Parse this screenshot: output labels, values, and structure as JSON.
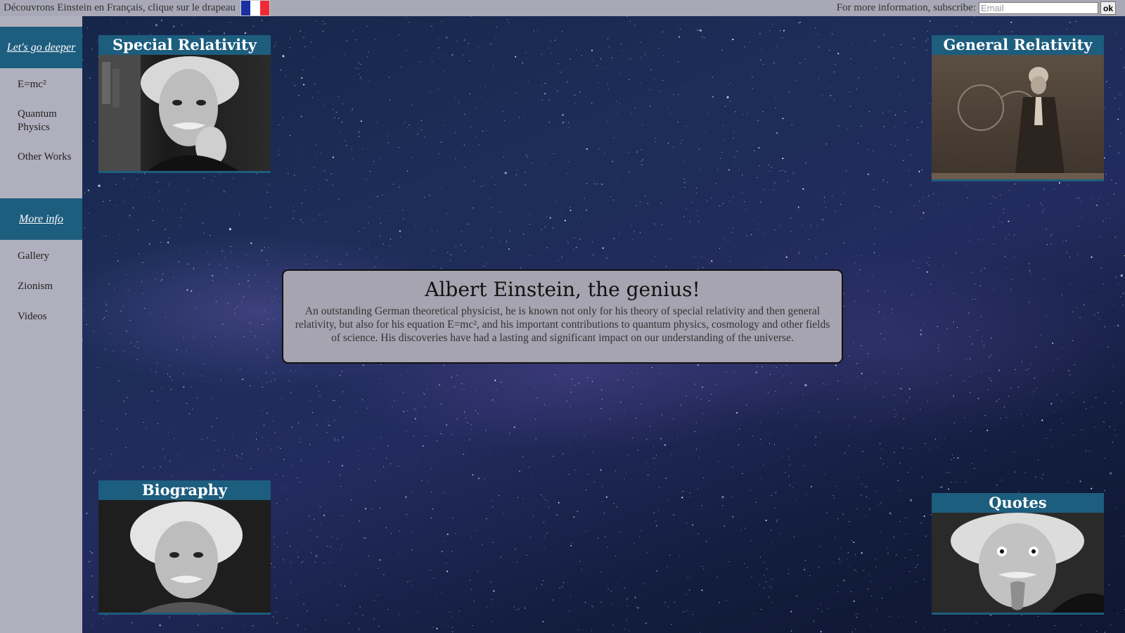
{
  "topbar": {
    "french_link_text": "Découvrons Einstein en Français, clique sur le drapeau",
    "subscribe_label": "For more information, subscribe:",
    "email_placeholder": "Email",
    "ok_label": "ok"
  },
  "sidebar": {
    "header1": "Let's go deeper",
    "group1": [
      "E=mc²",
      "Quantum Physics",
      "Other Works"
    ],
    "header2": "More info",
    "group2": [
      "Gallery",
      "Zionism",
      "Videos"
    ]
  },
  "cards": {
    "special": "Special Relativity",
    "general": "General Relativity",
    "biography": "Biography",
    "quotes": "Quotes"
  },
  "main": {
    "title": "Albert Einstein, the genius!",
    "description": "An outstanding German theoretical physicist, he is known not only for his theory of special relativity and then general relativity, but also for his equation E=mc², and his important contributions to quantum physics, cosmology and other fields of science. His discoveries have had a lasting and significant impact on our understanding of the universe."
  },
  "colors": {
    "accent": "#1d5d7e",
    "sidebar_bg": "#b0afbd",
    "topbar_bg": "#a9a8b6",
    "flag_blue": "#1a2fa0",
    "flag_white": "#ffffff",
    "flag_red": "#ee2a35"
  }
}
